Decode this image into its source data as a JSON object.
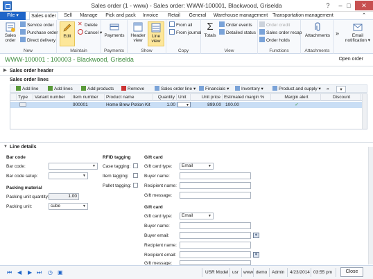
{
  "window": {
    "title": "Sales order (1 - www) - Sales order: WWW-100001, Blackwood, Griselda"
  },
  "tabs": [
    "File",
    "Sales order",
    "Sell",
    "Manage",
    "Pick and pack",
    "Invoice",
    "Retail",
    "General",
    "Warehouse management",
    "Transportation management"
  ],
  "ribbon": {
    "new": {
      "label": "New",
      "sales_order": "Sales order",
      "service_order": "Service order",
      "purchase_order": "Purchase order",
      "direct_delivery": "Direct delivery"
    },
    "maintain": {
      "label": "Maintain",
      "edit": "Edit",
      "delete": "Delete",
      "cancel": "Cancel"
    },
    "payments": {
      "label": "",
      "payments_btn": "Payments",
      "payments_label": "Payments"
    },
    "show": {
      "label": "Show",
      "header_view": "Header view",
      "line_view": "Line view"
    },
    "copy": {
      "label": "Copy",
      "from_all": "From all",
      "from_journal": "From journal"
    },
    "view": {
      "label": "View",
      "totals": "Totals",
      "order_events": "Order events",
      "detailed_status": "Detailed status"
    },
    "functions": {
      "label": "Functions",
      "order_credit": "Order credit",
      "sales_order_recap": "Sales order recap",
      "order_holds": "Order holds"
    },
    "attachments": {
      "label": "Attachments",
      "attachments_btn": "Attachments"
    },
    "email": {
      "label": "Email notification"
    }
  },
  "record": {
    "title": "WWW-100001 : 100003 - Blackwood, Griselda",
    "status": "Open order"
  },
  "sections": {
    "header": "Sales order header",
    "lines": "Sales order lines",
    "line_details": "Line details"
  },
  "grid_toolbar": {
    "add_line": "Add line",
    "add_lines": "Add lines",
    "add_products": "Add products",
    "remove": "Remove",
    "sales_order_line": "Sales order line",
    "financials": "Financials",
    "inventory": "Inventory",
    "product_and_supply": "Product and supply"
  },
  "grid": {
    "columns": [
      "Type",
      "Variant number",
      "Item number",
      "Product name",
      "Quantity",
      "Unit",
      "Unit price",
      "Estimated margin %",
      "Margin alert",
      "Discount"
    ],
    "rows": [
      {
        "type": "",
        "variant": "",
        "item": "900001",
        "product": "Home Brew Potion Kit",
        "quantity": "1.00",
        "unit": "",
        "unit_price": "899.00",
        "margin": "100.00",
        "alert": "✓",
        "discount": ""
      }
    ]
  },
  "details": {
    "bar_code": {
      "title": "Bar code",
      "bar_code_label": "Bar code:",
      "setup_label": "Bar code setup:"
    },
    "packing": {
      "title": "Packing material",
      "qty_label": "Packing unit quantity:",
      "qty_value": "1.00",
      "unit_label": "Packing unit:",
      "unit_value": "cube"
    },
    "rfid": {
      "title": "RFID tagging",
      "case": "Case tagging:",
      "item": "Item tagging:",
      "pallet": "Pallet tagging:"
    },
    "gift1": {
      "title": "Gift card",
      "type_label": "Gift card type:",
      "type_value": "Email",
      "buyer_name": "Buyer name:",
      "recipient_name": "Recipient name:",
      "message": "Gift message:"
    },
    "gift2": {
      "title": "Gift card",
      "type_label": "Gift card type:",
      "type_value": "Email",
      "buyer_name": "Buyer name:",
      "buyer_email": "Buyer email:",
      "recipient_name": "Recipient name:",
      "recipient_email": "Recipient email:",
      "message": "Gift message:"
    }
  },
  "statusbar": {
    "model": "USR Model",
    "user": "usr",
    "company": "www",
    "partition": "demo",
    "role": "Admin",
    "date": "4/23/2014",
    "time": "03:55 pm",
    "close": "Close"
  },
  "colors": {
    "accent": "#1e64c8",
    "record_title": "#3a8a3a",
    "selected_row": "#c9def5",
    "edit_highlight": "#fde79a"
  }
}
